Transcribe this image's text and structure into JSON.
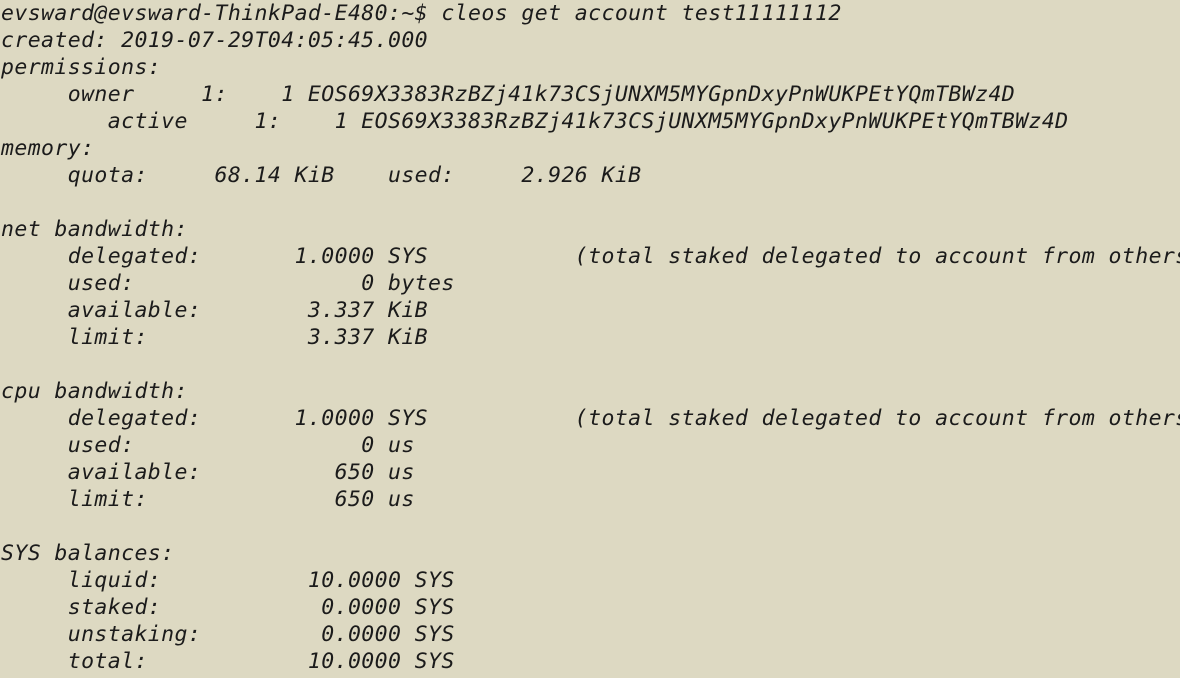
{
  "terminal": {
    "prompt": "evsward@evsward-ThinkPad-E480:~$ ",
    "command": "cleos get account test11111112",
    "created": "created: 2019-07-29T04:05:45.000",
    "permissions_header": "permissions:",
    "owner_line": "     owner     1:    1 EOS69X3383RzBZj41k73CSjUNXM5MYGpnDxyPnWUKPEtYQmTBWz4D",
    "active_line": "        active     1:    1 EOS69X3383RzBZj41k73CSjUNXM5MYGpnDxyPnWUKPEtYQmTBWz4D",
    "memory_header": "memory:",
    "memory_line": "     quota:     68.14 KiB    used:     2.926 KiB",
    "net_header": "net bandwidth:",
    "net_delegated": "     delegated:       1.0000 SYS           (total staked delegated to account from others)",
    "net_used": "     used:                 0 bytes",
    "net_available": "     available:        3.337 KiB",
    "net_limit": "     limit:            3.337 KiB",
    "cpu_header": "cpu bandwidth:",
    "cpu_delegated": "     delegated:       1.0000 SYS           (total staked delegated to account from others)",
    "cpu_used": "     used:                 0 us",
    "cpu_available": "     available:          650 us",
    "cpu_limit": "     limit:              650 us",
    "balances_header": "SYS balances:",
    "liquid": "     liquid:           10.0000 SYS",
    "staked": "     staked:            0.0000 SYS",
    "unstaking": "     unstaking:         0.0000 SYS",
    "total": "     total:            10.0000 SYS"
  }
}
